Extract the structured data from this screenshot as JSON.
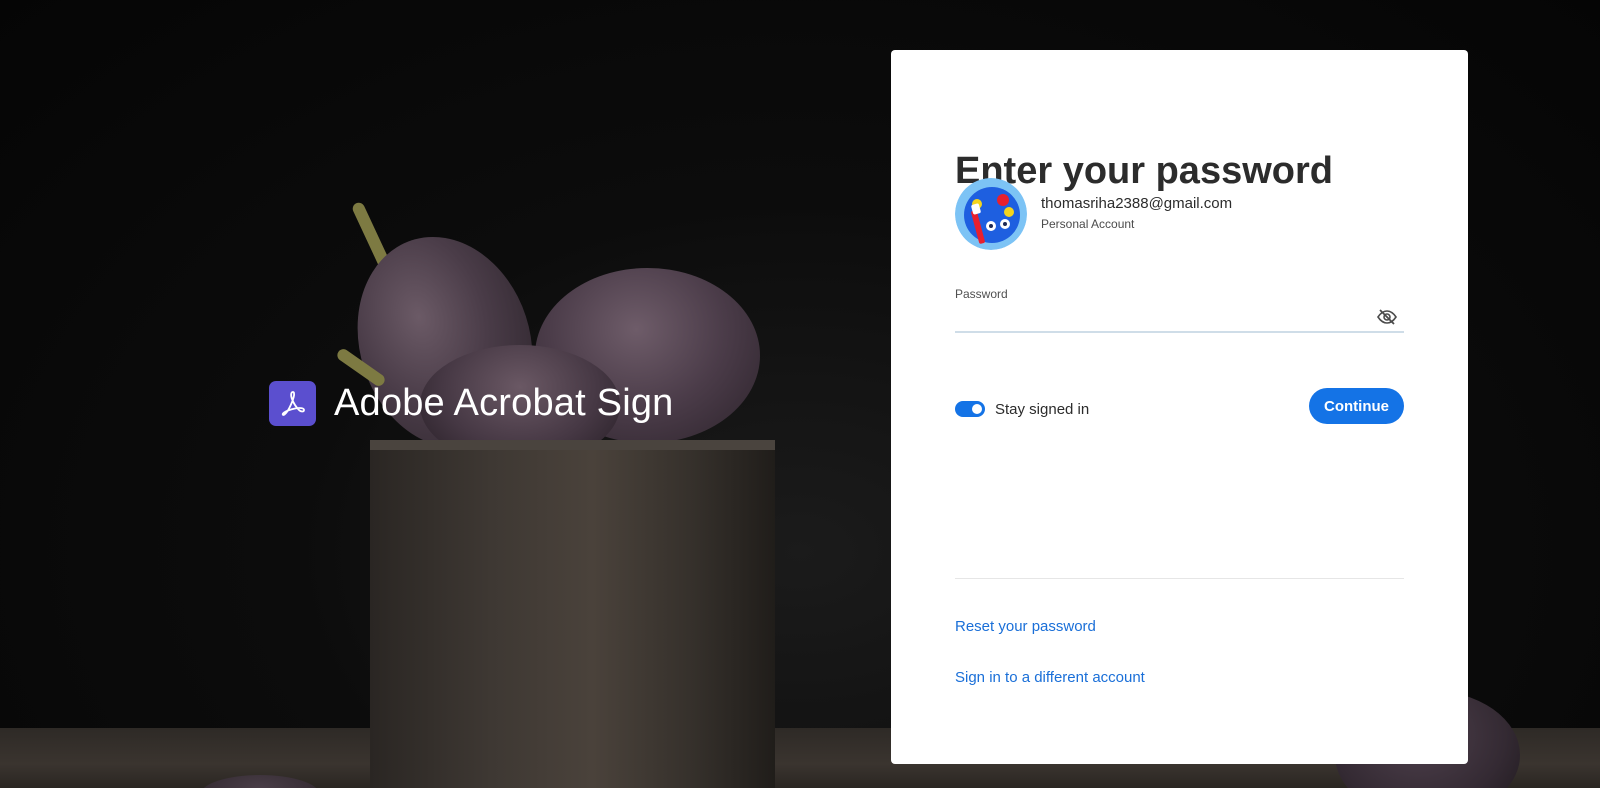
{
  "brand": {
    "name": "Adobe Acrobat Sign",
    "logo_icon": "acrobat-logo-icon",
    "logo_color": "#5b4fcf"
  },
  "card": {
    "title": "Enter your password",
    "account": {
      "email": "thomasriha2388@gmail.com",
      "type": "Personal Account",
      "avatar_icon": "paint-palette-avatar"
    },
    "password": {
      "label": "Password",
      "value": "",
      "visibility_icon": "eye-slash-icon"
    },
    "stay_signed_in": {
      "label": "Stay signed in",
      "checked": true
    },
    "continue_label": "Continue",
    "links": {
      "reset": "Reset your password",
      "switch_account": "Sign in to a different account"
    }
  },
  "colors": {
    "accent": "#1473e6",
    "link": "#1a6fd8",
    "background": "#0c0c0c"
  }
}
